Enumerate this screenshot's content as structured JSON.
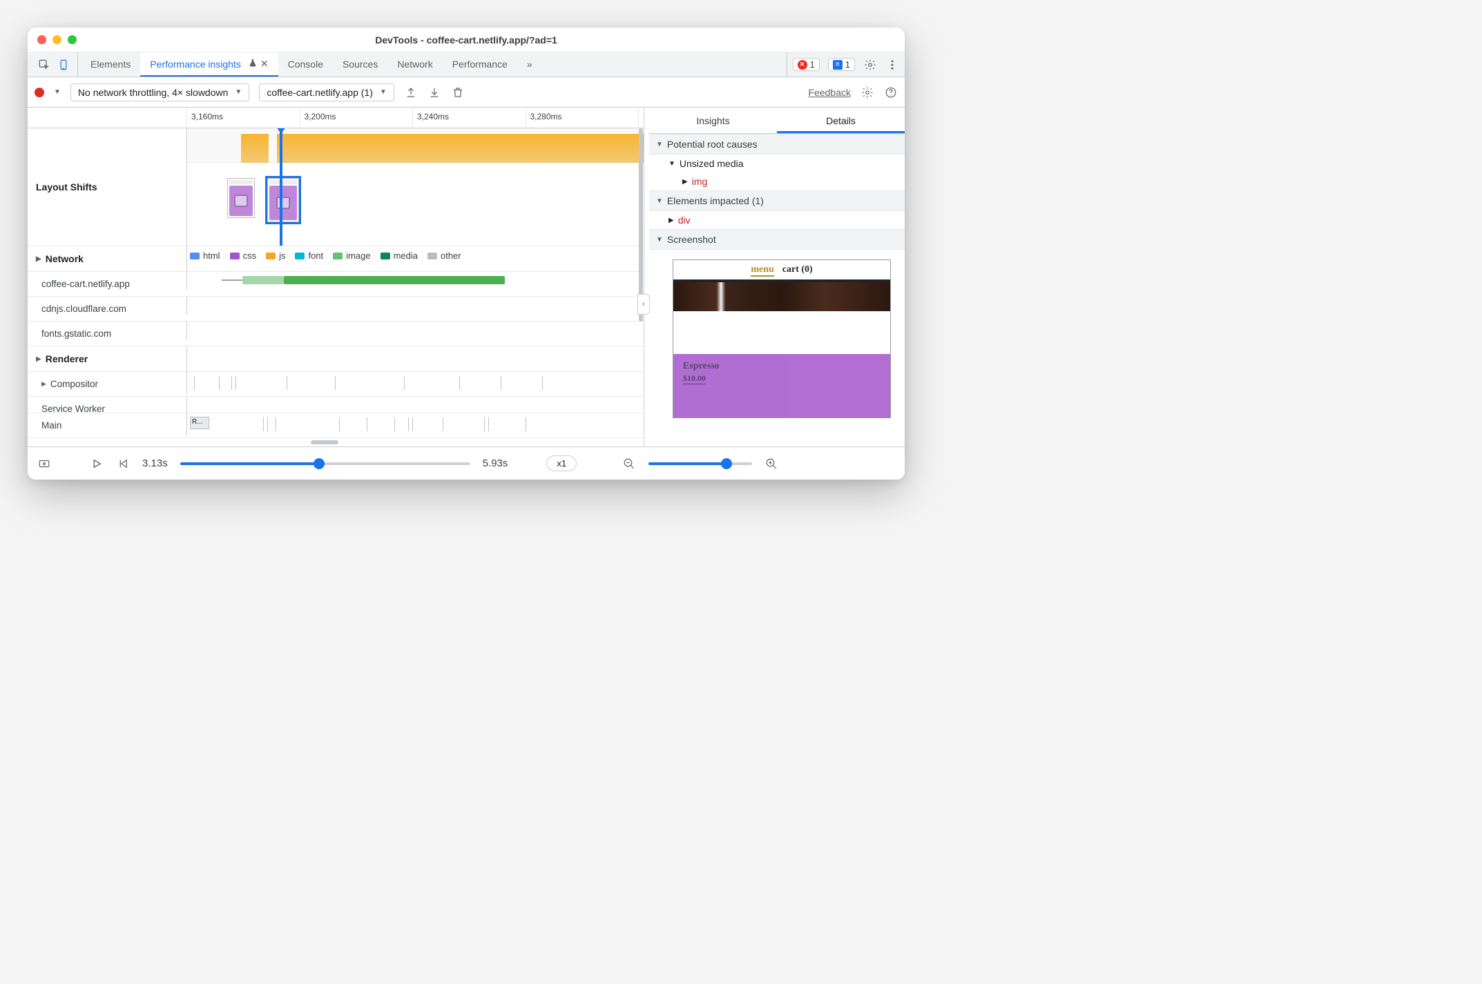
{
  "window": {
    "title": "DevTools - coffee-cart.netlify.app/?ad=1"
  },
  "tabs": {
    "elements": "Elements",
    "performance_insights": "Performance insights",
    "console": "Console",
    "sources": "Sources",
    "network": "Network",
    "performance": "Performance",
    "overflow": "»"
  },
  "badges": {
    "errors": "1",
    "issues": "1"
  },
  "toolbar": {
    "throttling": "No network throttling, 4× slowdown",
    "page_select": "coffee-cart.netlify.app (1)",
    "feedback": "Feedback"
  },
  "ruler": [
    "3,160ms",
    "3,200ms",
    "3,240ms",
    "3,280ms"
  ],
  "tracks": {
    "layout_shifts": "Layout Shifts",
    "network": "Network",
    "hosts": [
      "coffee-cart.netlify.app",
      "cdnjs.cloudflare.com",
      "fonts.gstatic.com"
    ],
    "renderer": "Renderer",
    "compositor": "Compositor",
    "service_worker": "Service Worker",
    "main": "Main",
    "main_task": "R..."
  },
  "legend": {
    "html": "html",
    "css": "css",
    "js": "js",
    "font": "font",
    "image": "image",
    "media": "media",
    "other": "other"
  },
  "legend_colors": {
    "html": "#4f8ff7",
    "css": "#a455cb",
    "js": "#f5a623",
    "font": "#00b8d4",
    "image": "#62c174",
    "media": "#0b8a4a",
    "other": "#bdbdbd"
  },
  "details": {
    "tab_insights": "Insights",
    "tab_details": "Details",
    "root_causes": "Potential root causes",
    "unsized_media": "Unsized media",
    "img_tag": "img",
    "elements_impacted": "Elements impacted (1)",
    "div_tag": "div",
    "screenshot": "Screenshot",
    "preview": {
      "menu": "menu",
      "cart": "cart (0)",
      "product": "Espresso",
      "price": "$10.00"
    }
  },
  "bottombar": {
    "start": "3.13s",
    "end": "5.93s",
    "speed": "x1"
  }
}
